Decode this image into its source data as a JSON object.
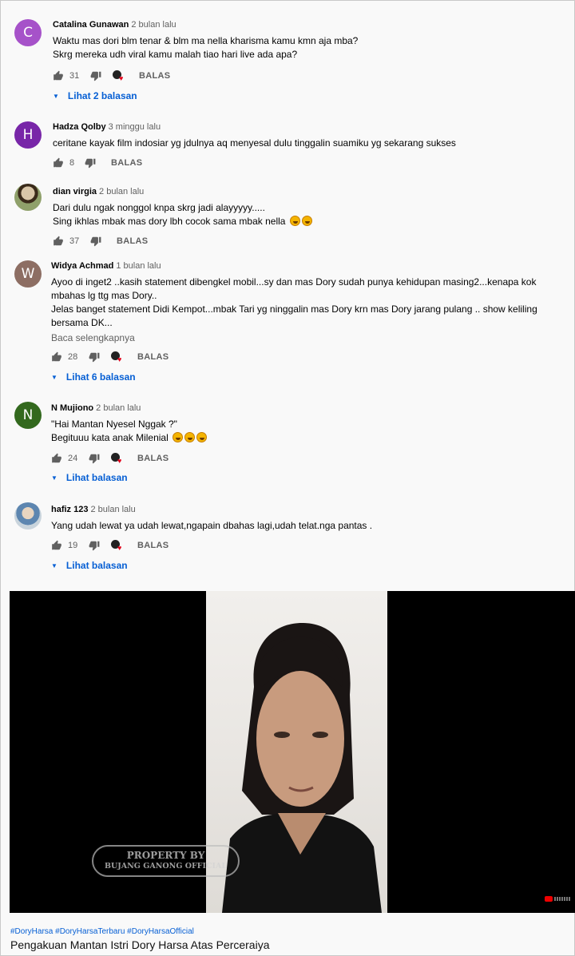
{
  "comments": [
    {
      "author": "Catalina Gunawan",
      "time": "2 bulan lalu",
      "avatar_letter": "C",
      "avatar_color": "#a652c9",
      "lines": [
        "Waktu mas dori blm tenar & blm ma nella kharisma kamu kmn aja mba?",
        "Skrg  mereka udh viral kamu malah tiao hari live ada apa?"
      ],
      "likes": "31",
      "reply_label": "BALAS",
      "replies_label": "Lihat 2 balasan"
    },
    {
      "author": "Hadza Qolby",
      "time": "3 minggu lalu",
      "avatar_letter": "H",
      "avatar_color": "#7826a8",
      "lines": [
        "ceritane kayak film indosiar yg jdulnya aq menyesal dulu tinggalin suamiku yg sekarang sukses"
      ],
      "likes": "8",
      "reply_label": "BALAS"
    },
    {
      "author": "dian virgia",
      "time": "2 bulan lalu",
      "lines": [
        "Dari dulu ngak nonggol knpa skrg jadi alayyyyy.....",
        "Sing ikhlas mbak  mas dory lbh cocok sama mbak nella"
      ],
      "likes": "37",
      "reply_label": "BALAS"
    },
    {
      "author": "Widya Achmad",
      "time": "1 bulan lalu",
      "avatar_letter": "W",
      "avatar_color": "#8d6e63",
      "lines": [
        "Ayoo di inget2  ..kasih statement dibengkel mobil...sy dan mas Dory sudah punya kehidupan masing2...kenapa kok",
        "mbahas lg ttg mas Dory..",
        "Jelas banget statement Didi Kempot...mbak Tari yg ninggalin mas Dory krn mas Dory jarang pulang .. show keliling",
        "bersama DK..."
      ],
      "read_more": "Baca selengkapnya",
      "likes": "28",
      "reply_label": "BALAS",
      "replies_label": "Lihat 6 balasan"
    },
    {
      "author": "N Mujiono",
      "time": "2 bulan lalu",
      "avatar_letter": "N",
      "avatar_color": "#33691e",
      "lines": [
        "\"Hai Mantan Nyesel Nggak ?\"",
        "Begituuu kata anak Milenial"
      ],
      "likes": "24",
      "reply_label": "BALAS",
      "replies_label": "Lihat balasan"
    },
    {
      "author": "hafiz 123",
      "time": "2 bulan lalu",
      "lines": [
        "Yang udah lewat ya udah lewat,ngapain dbahas lagi,udah telat.nga pantas ."
      ],
      "likes": "19",
      "reply_label": "BALAS",
      "replies_label": "Lihat balasan"
    }
  ],
  "video": {
    "watermark_line1": "PROPERTY BY",
    "watermark_line2": "BUJANG GANONG OFFICIAL",
    "hashtags": "#DoryHarsa #DoryHarsaTerbaru #DoryHarsaOfficial",
    "title": "Pengakuan Mantan Istri Dory Harsa Atas Perceraiya"
  },
  "colors": {
    "link": "#065fd4",
    "meta": "#606060",
    "heart": "#e3001a"
  }
}
